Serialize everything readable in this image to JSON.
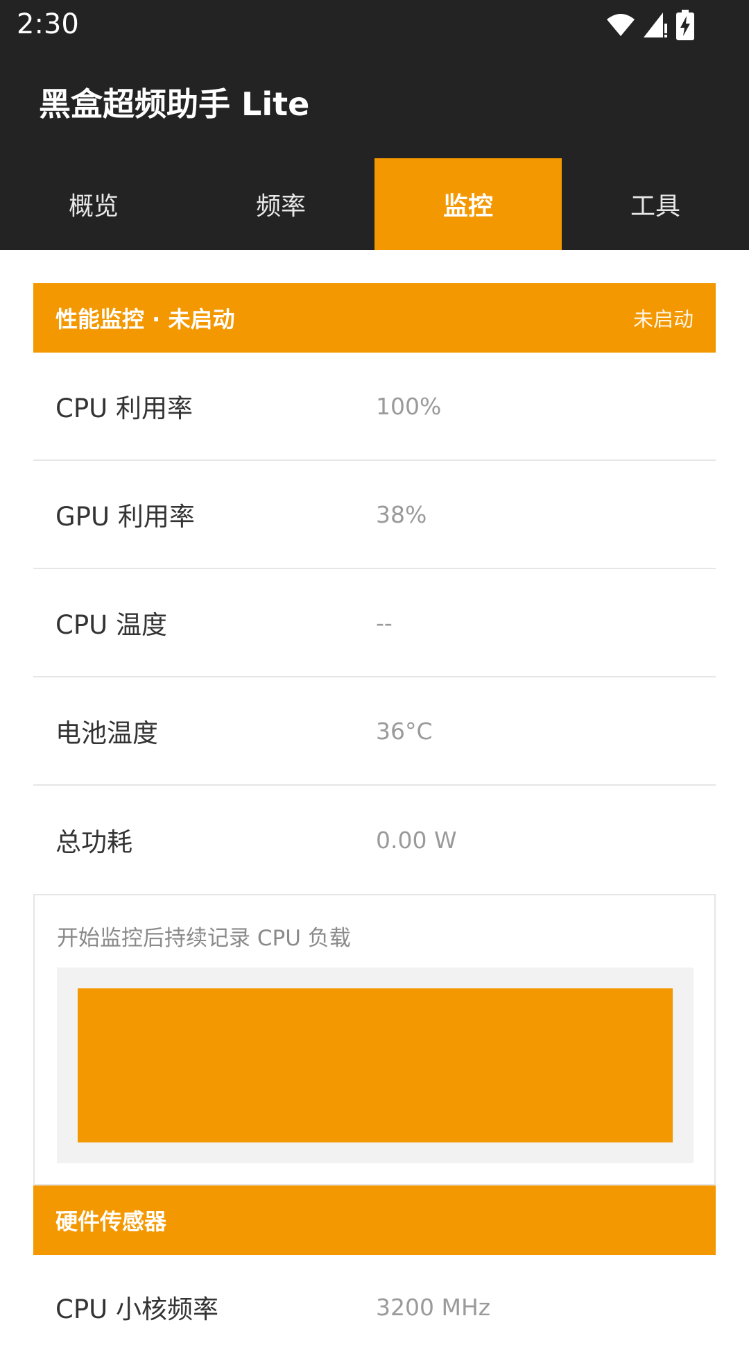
{
  "status_bar": {
    "time": "2:30",
    "icons": [
      "wifi-icon",
      "cellular-signal-icon",
      "battery-charging-icon"
    ]
  },
  "app": {
    "title": "黑盒超频助手 Lite"
  },
  "tabs": [
    {
      "label": "概览",
      "active": false
    },
    {
      "label": "频率",
      "active": false
    },
    {
      "label": "监控",
      "active": true
    },
    {
      "label": "工具",
      "active": false
    }
  ],
  "monitor": {
    "header_title": "性能监控 · 未启动",
    "header_status": "未启动",
    "rows": [
      {
        "label": "CPU 利用率",
        "value": "100%"
      },
      {
        "label": "GPU 利用率",
        "value": "38%"
      },
      {
        "label": "CPU 温度",
        "value": "--"
      },
      {
        "label": "电池温度",
        "value": "36°C"
      },
      {
        "label": "总功耗",
        "value": "0.00 W"
      }
    ],
    "chart_caption": "开始监控后持续记录 CPU 负载",
    "cpu_load_fill": 1.0
  },
  "sensors": {
    "header_title": "硬件传感器",
    "rows": [
      {
        "label": "CPU 小核频率",
        "value": "3200 MHz"
      }
    ]
  },
  "colors": {
    "accent": "#f39800",
    "dark_bar": "#232323",
    "divider": "#e6e6e6",
    "value_text": "#9a9a9a"
  }
}
